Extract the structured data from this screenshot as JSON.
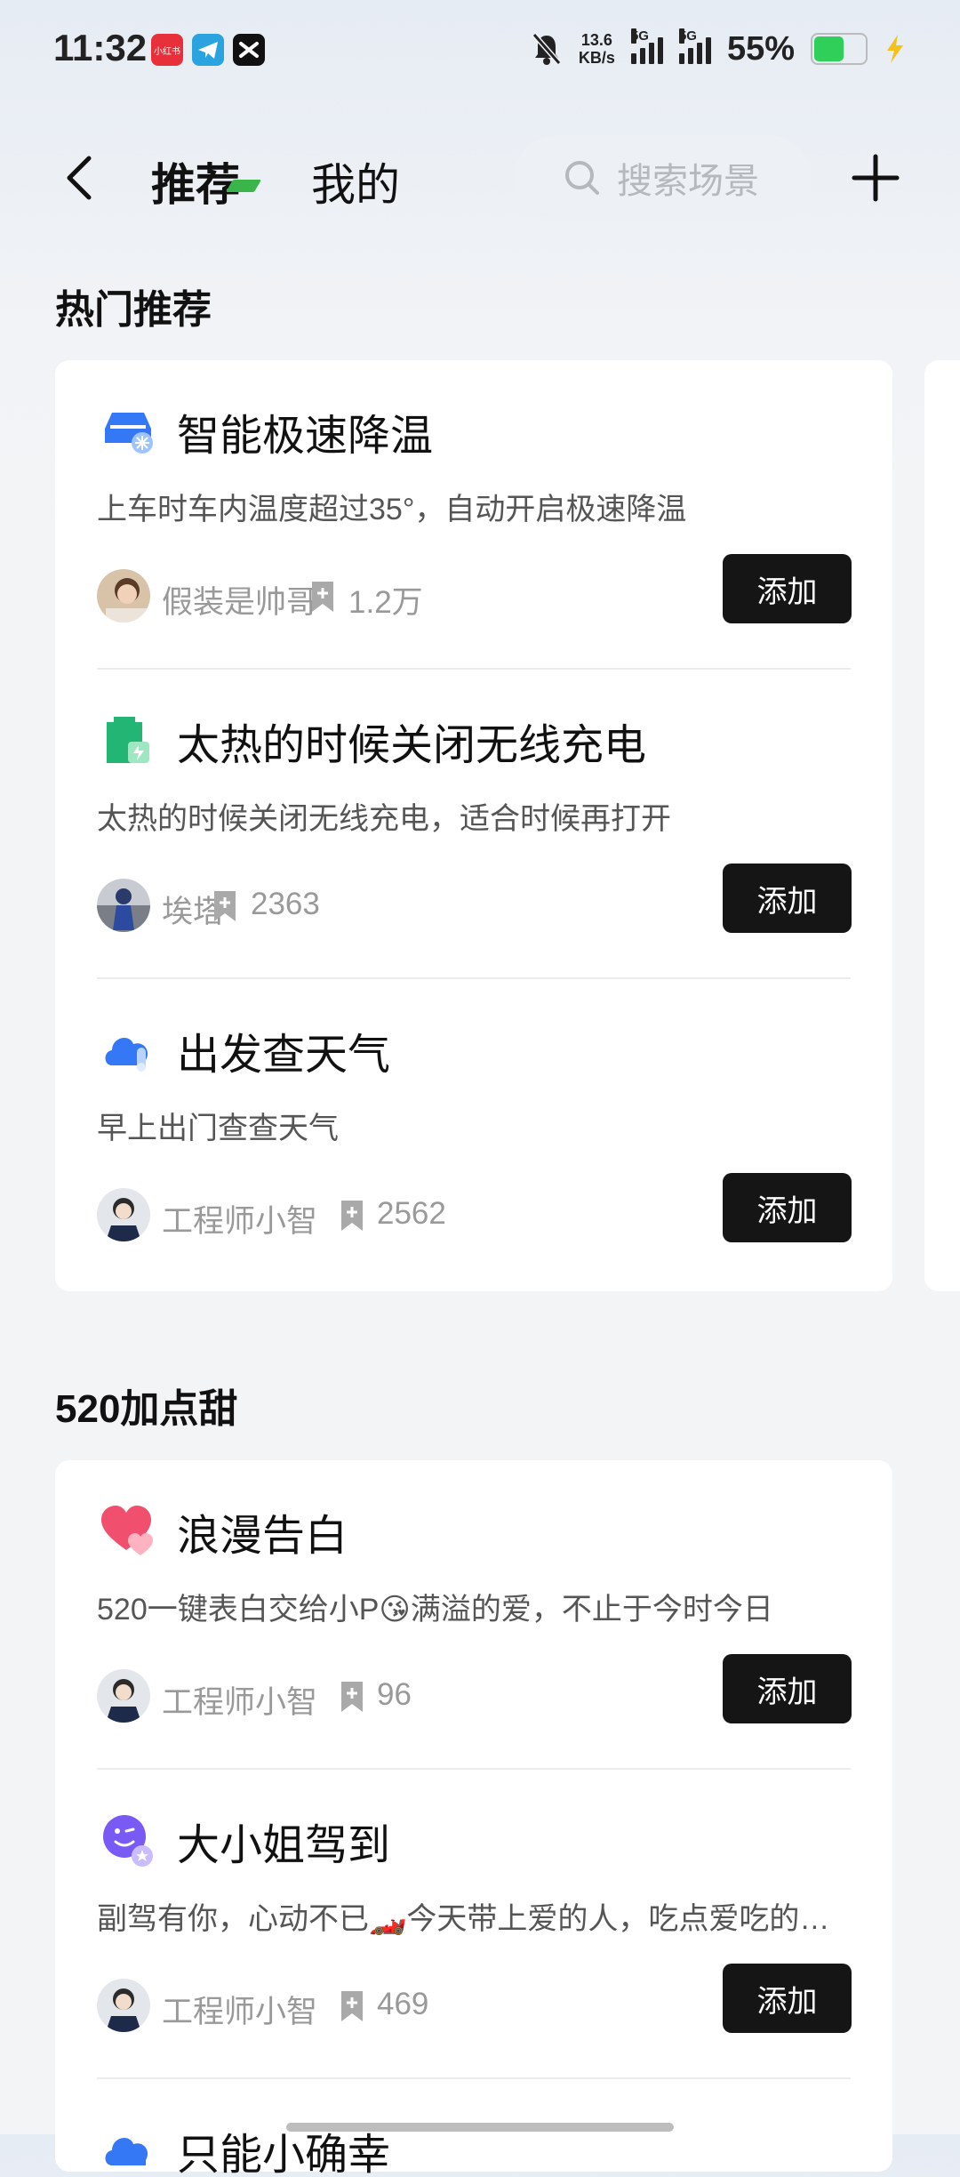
{
  "status_bar": {
    "time": "11:32",
    "net_speed_value": "13.6",
    "net_speed_unit": "KB/s",
    "network_1": "5G",
    "network_2": "5G",
    "battery_percent": "55%",
    "battery_level": 0.55,
    "icons": [
      "xiaohongshu-app-icon",
      "telegram-app-icon",
      "capcut-app-icon",
      "mute-bell-icon",
      "signal-icon",
      "battery-icon",
      "charging-icon"
    ],
    "app_icon_colors": [
      "#e8303a",
      "#2aa3e0",
      "#111111"
    ]
  },
  "header": {
    "tab_recommend": "推荐",
    "tab_mine": "我的",
    "search_placeholder": "搜索场景",
    "active_tab_mark_color": "#39b54a"
  },
  "sections": [
    {
      "title": "热门推荐",
      "items": [
        {
          "title": "智能极速降温",
          "desc": "上车时车内温度超过35°，自动开启极速降温",
          "author": "假装是帅哥",
          "count": "1.2万",
          "add": "添加",
          "icon": "car-cooling-icon",
          "icon_color": "#3478f6"
        },
        {
          "title": "太热的时候关闭无线充电",
          "desc": "太热的时候关闭无线充电，适合时候再打开",
          "author": "埃塔",
          "count": "2363",
          "add": "添加",
          "icon": "wireless-charging-icon",
          "icon_color": "#22b573"
        },
        {
          "title": "出发查天气",
          "desc": "早上出门查查天气",
          "author": "工程师小智",
          "count": "2562",
          "add": "添加",
          "icon": "weather-cloud-icon",
          "icon_color": "#3478f6"
        }
      ]
    },
    {
      "title": "520加点甜",
      "items": [
        {
          "title": "浪漫告白",
          "desc": "520一键表白交给小P😘满溢的爱，不止于今时今日",
          "author": "工程师小智",
          "count": "96",
          "add": "添加",
          "icon": "heart-icon",
          "icon_color": "#f0506e"
        },
        {
          "title": "大小姐驾到",
          "desc": "副驾有你，心动不已🏎️今天带上爱的人，吃点爱吃的…",
          "author": "工程师小智",
          "count": "469",
          "add": "添加",
          "icon": "wink-face-icon",
          "icon_color": "#7a5af5"
        },
        {
          "title": "只能小确幸",
          "desc": "",
          "author": "",
          "count": "",
          "add": "",
          "icon": "weather-cloud-icon",
          "icon_color": "#3478f6"
        }
      ]
    }
  ]
}
